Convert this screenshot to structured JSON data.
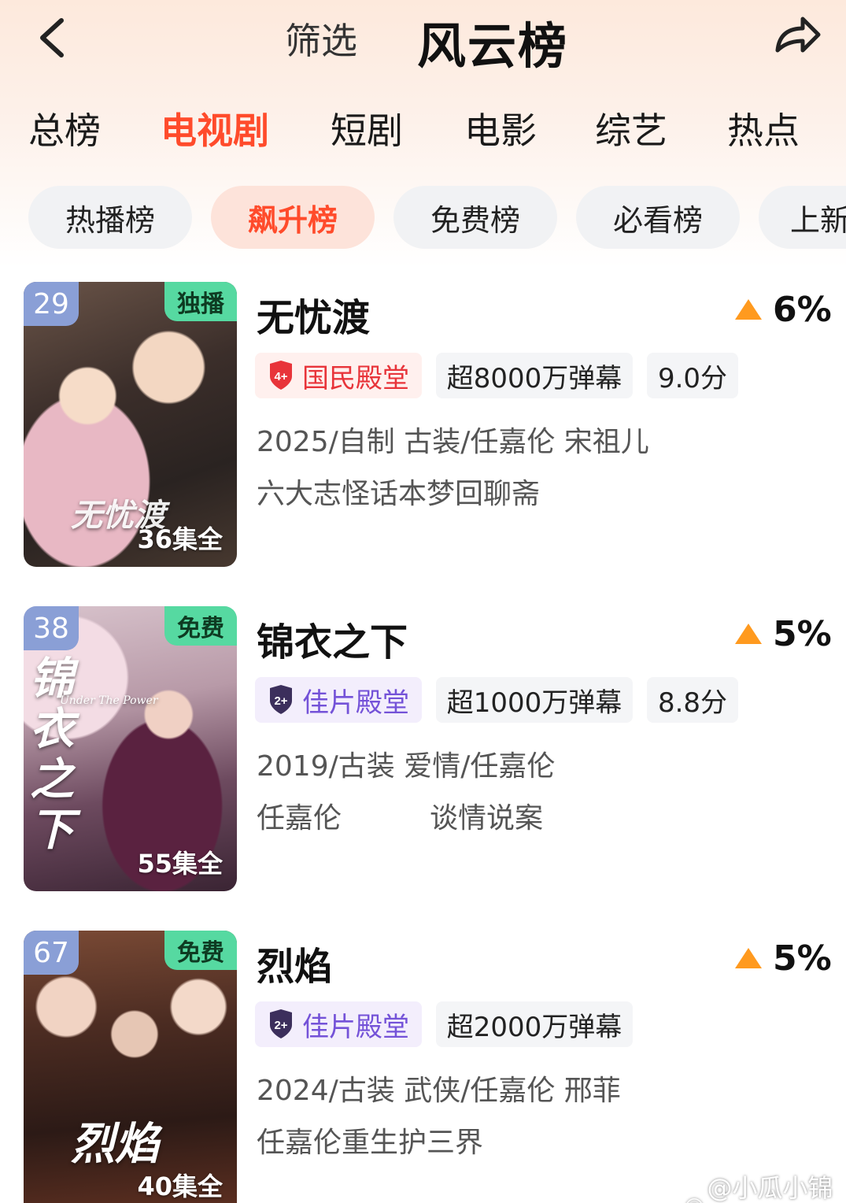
{
  "header": {
    "filter_label": "筛选",
    "title": "风云榜",
    "back_icon": "chevron-left-icon",
    "share_icon": "share-arrow-icon"
  },
  "category_tabs": [
    {
      "label": "总榜",
      "active": false
    },
    {
      "label": "电视剧",
      "active": true
    },
    {
      "label": "短剧",
      "active": false
    },
    {
      "label": "电影",
      "active": false
    },
    {
      "label": "综艺",
      "active": false
    },
    {
      "label": "热点",
      "active": false
    }
  ],
  "rank_chips": [
    {
      "label": "热播榜",
      "active": false
    },
    {
      "label": "飙升榜",
      "active": true
    },
    {
      "label": "免费榜",
      "active": false
    },
    {
      "label": "必看榜",
      "active": false
    },
    {
      "label": "上新",
      "active": false
    }
  ],
  "colors": {
    "accent": "#ff4b2b",
    "rise_arrow": "#ff9a1f",
    "rank_badge": "#8a9fd6",
    "tag_badge": "#56d9a1",
    "honor_red": "#e8343a",
    "honor_purple": "#7452d8"
  },
  "items": [
    {
      "rank": "29",
      "tag": "独播",
      "episodes": "36集全",
      "poster_title": "无忧渡",
      "title": "无忧渡",
      "change": "6%",
      "honor": {
        "label": "国民殿堂",
        "level": "4+",
        "style": "red"
      },
      "danmaku": "超8000万弹幕",
      "score": "9.0分",
      "meta": "2025/自制 古装/任嘉伦 宋祖儿",
      "desc": "六大志怪话本梦回聊斋",
      "desc_sub": ""
    },
    {
      "rank": "38",
      "tag": "免费",
      "episodes": "55集全",
      "poster_title": "锦衣之下",
      "poster_subtitle": "Under The Power",
      "title": "锦衣之下",
      "change": "5%",
      "honor": {
        "label": "佳片殿堂",
        "level": "2+",
        "style": "purple"
      },
      "danmaku": "超1000万弹幕",
      "score": "8.8分",
      "meta": "2019/古装 爱情/任嘉伦",
      "desc": "任嘉伦",
      "desc_sub": "谈情说案"
    },
    {
      "rank": "67",
      "tag": "免费",
      "episodes": "40集全",
      "poster_title": "烈焰",
      "title": "烈焰",
      "change": "5%",
      "honor": {
        "label": "佳片殿堂",
        "level": "2+",
        "style": "purple"
      },
      "danmaku": "超2000万弹幕",
      "score": "",
      "meta": "2024/古装 武侠/任嘉伦 邢菲",
      "desc": "任嘉伦重生护三界",
      "desc_sub": ""
    }
  ],
  "watermark": "@小瓜小锦鲤"
}
